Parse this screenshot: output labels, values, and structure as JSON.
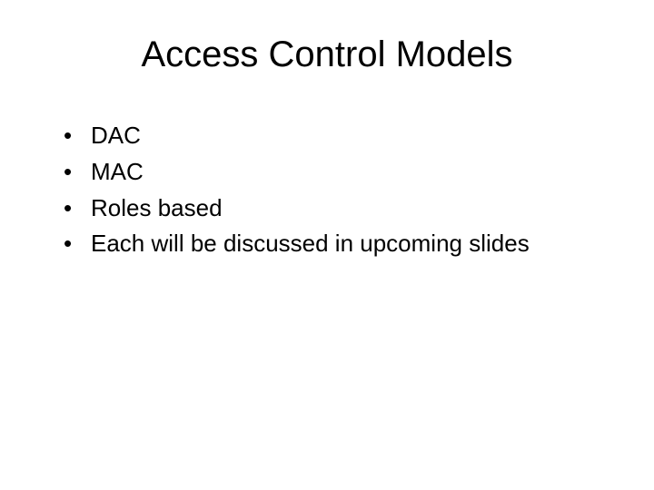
{
  "title": "Access Control Models",
  "bullets": [
    "DAC",
    "MAC",
    "Roles based",
    "Each will be discussed in upcoming slides"
  ]
}
